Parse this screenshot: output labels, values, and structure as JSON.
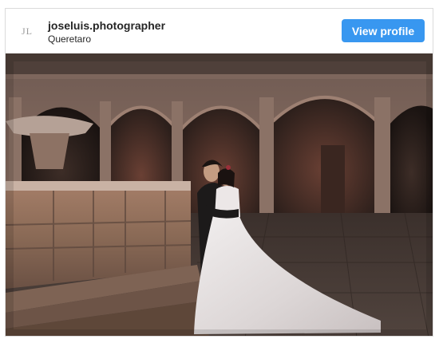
{
  "profile": {
    "avatar_initials": "JL",
    "username": "joseluis.photographer",
    "location": "Queretaro",
    "view_profile_label": "View profile"
  },
  "colors": {
    "button": "#3897f0",
    "border": "#dbdbdb",
    "text": "#262626"
  },
  "post": {
    "image_subject": "wedding-couple-courtyard-photo"
  }
}
